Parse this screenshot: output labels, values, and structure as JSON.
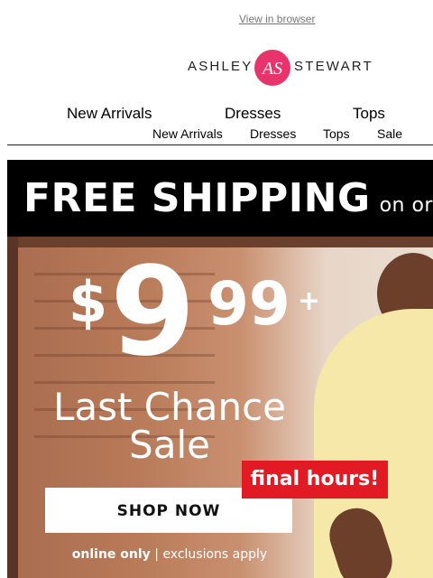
{
  "header": {
    "view_in_browser": "View in browser",
    "logo_left": "ASHLEY",
    "logo_right": "STEWART",
    "logo_mark": "AS"
  },
  "nav_primary": [
    "New Arrivals",
    "Dresses",
    "Tops"
  ],
  "nav_secondary": [
    "New Arrivals",
    "Dresses",
    "Tops",
    "Sale"
  ],
  "banner": {
    "bold": "FREE SHIPPING",
    "small": "on orc"
  },
  "hero": {
    "dollar": "$",
    "price_main": "9",
    "price_cents": "99",
    "price_plus": "+",
    "sale_line1": "Last Chance",
    "sale_line2": "Sale",
    "badge": "final hours!",
    "cta": "SHOP NOW",
    "footnote_bold": "online only",
    "footnote_sep": " | ",
    "footnote_rest": "exclusions apply"
  },
  "colors": {
    "brand_pink": "#e8336b",
    "badge_red": "#e11a24",
    "banner_bg": "#000000"
  }
}
